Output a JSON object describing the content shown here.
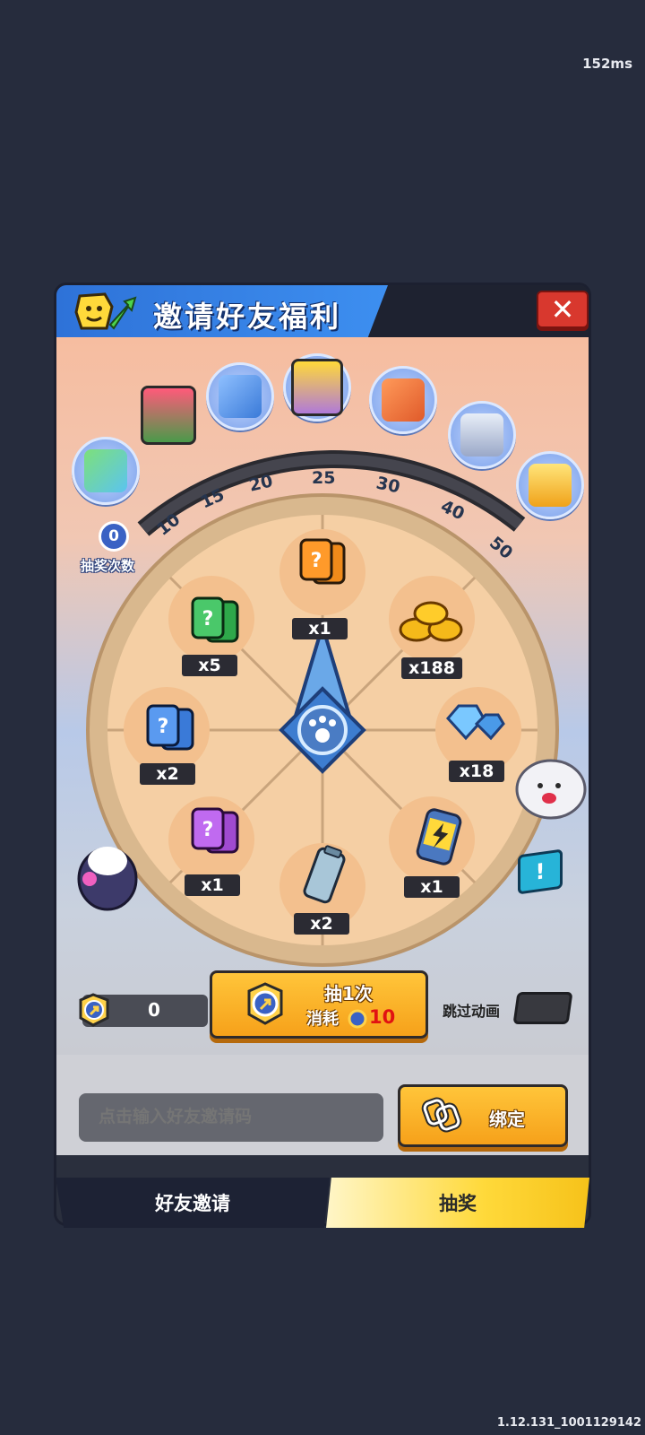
{
  "status": {
    "ping": "152ms",
    "version": "1.12.131_1001129142"
  },
  "header": {
    "title": "邀请好友福利",
    "close_icon": "close-icon"
  },
  "progress": {
    "draw_count": "0",
    "draw_count_label": "抽奖次数",
    "milestones": [
      "10",
      "15",
      "20",
      "25",
      "30",
      "40",
      "50"
    ]
  },
  "wheel": {
    "prizes": [
      {
        "icon": "orange-mystery-card",
        "qty": "x1"
      },
      {
        "icon": "gold-coins",
        "qty": "x188"
      },
      {
        "icon": "blue-diamonds",
        "qty": "x18"
      },
      {
        "icon": "energy-battery",
        "qty": "x1"
      },
      {
        "icon": "silver-battery",
        "qty": "x2"
      },
      {
        "icon": "purple-mystery-card",
        "qty": "x1"
      },
      {
        "icon": "blue-mystery-card",
        "qty": "x2"
      },
      {
        "icon": "green-mystery-card",
        "qty": "x5"
      }
    ]
  },
  "controls": {
    "token_count": "0",
    "draw_button": {
      "title": "抽1次",
      "cost_label": "消耗",
      "cost_value": "10"
    },
    "skip_animation_label": "跳过动画",
    "skip_animation_on": false
  },
  "invite": {
    "placeholder": "点击输入好友邀请码",
    "bind_label": "绑定"
  },
  "tabs": {
    "invite": "好友邀请",
    "draw": "抽奖"
  },
  "colors": {
    "accent_orange": "#f6a11a",
    "header_blue": "#3d8ff0",
    "close_red": "#d8382e"
  }
}
